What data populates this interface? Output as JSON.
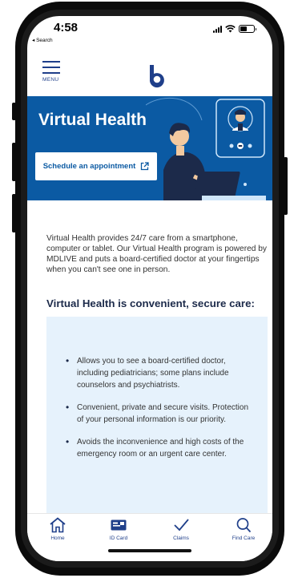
{
  "status_bar": {
    "time": "4:58",
    "back_label": "◂ Search"
  },
  "header": {
    "menu_label": "MENU",
    "logo": "b"
  },
  "hero": {
    "title": "Virtual Health",
    "cta_label": "Schedule an appointment",
    "background_color": "#0b5aa3"
  },
  "main": {
    "intro": "Virtual Health provides 24/7 care from a smartphone, computer or tablet. Our Virtual Health program is powered by MDLIVE and puts a board-certified doctor at your fingertips when you can't see one in person.",
    "subheading": "Virtual Health is convenient, secure care:",
    "benefits": [
      "Allows you to see a board-certified doctor, including pediatricians; some plans include counselors and psychiatrists.",
      "Convenient, private and secure visits. Protection of your personal information is our priority.",
      "Avoids the inconvenience and high costs of the emergency room or an urgent care center."
    ]
  },
  "tabbar": {
    "tabs": [
      {
        "label": "Home",
        "icon": "home-icon"
      },
      {
        "label": "ID Card",
        "icon": "id-card-icon"
      },
      {
        "label": "Claims",
        "icon": "checkmark-icon"
      },
      {
        "label": "Find Care",
        "icon": "search-icon"
      }
    ]
  },
  "colors": {
    "brand_dark": "#1f3f8a",
    "hero_blue": "#0b5aa3",
    "light_panel": "#e6f2fc"
  }
}
